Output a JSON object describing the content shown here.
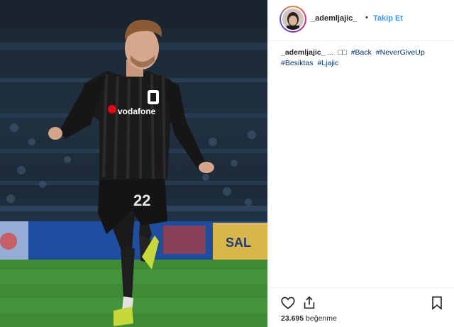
{
  "post": {
    "username": "_ademljajic_",
    "separator": "•",
    "follow_label": "Takip Et",
    "caption": {
      "username": "_ademljajic_",
      "text_prefix": "...",
      "emoji": "□□",
      "hashtags": [
        "#Back",
        "#NeverGiveUp",
        "#Besiktas",
        "#Ljajic"
      ]
    },
    "likes_count": "23.695",
    "likes_label": "beğenme",
    "photo": {
      "jersey_sponsor": "vodafone",
      "jersey_number": "22",
      "ad_board_text": "SAL"
    }
  },
  "icons": {
    "like": "heart-icon",
    "share": "share-icon",
    "save": "bookmark-icon"
  },
  "colors": {
    "link": "#003569",
    "follow": "#3897f0",
    "text": "#262626",
    "border": "#efefef"
  }
}
